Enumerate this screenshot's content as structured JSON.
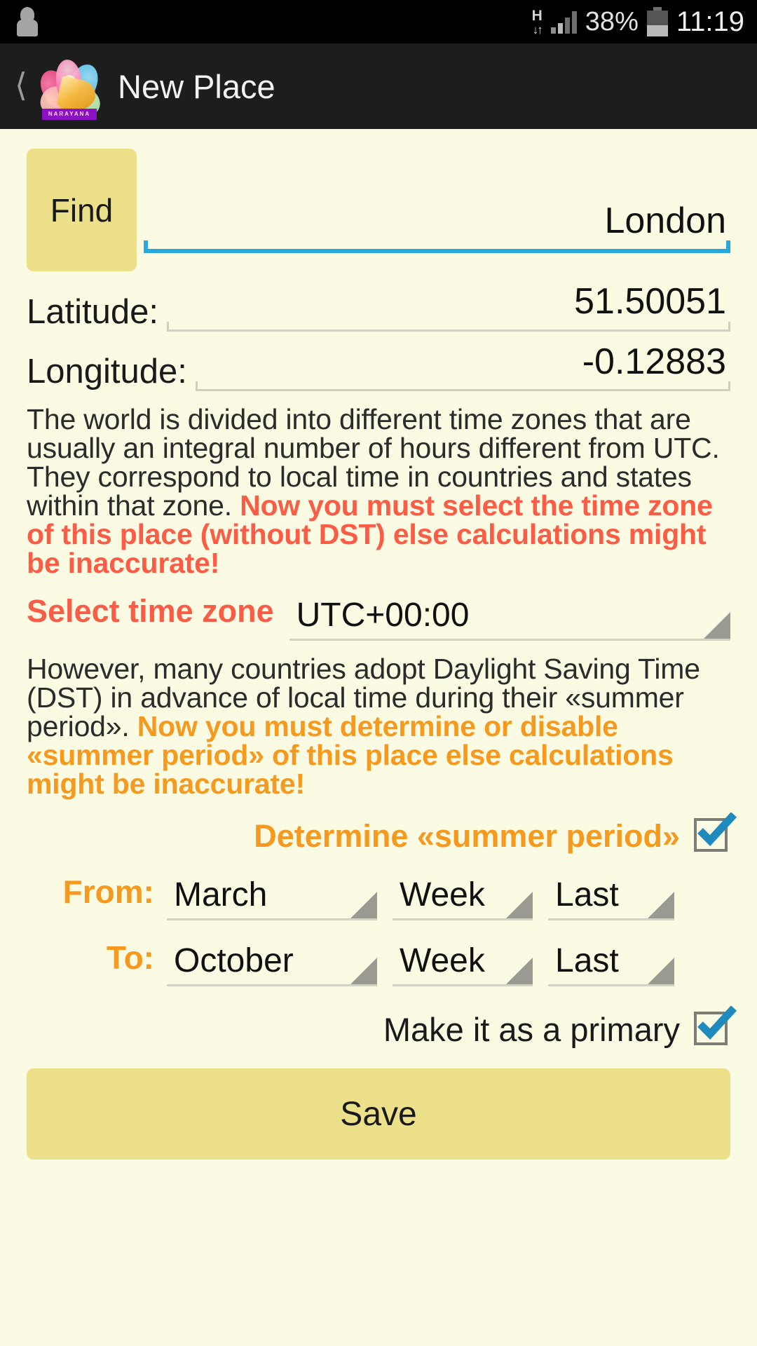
{
  "statusbar": {
    "notification_icon": "statue-icon",
    "network_type": "H",
    "network_arrows": "↓↑",
    "signal_icon": "signal-bars-icon",
    "battery_percent": "38%",
    "battery_icon": "battery-icon",
    "clock": "11:19"
  },
  "actionbar": {
    "back_icon": "back-chevron-icon",
    "app_logo": "lotus-logo-icon",
    "logo_ribbon": "NARAYANA",
    "title": "New Place"
  },
  "form": {
    "find_button": "Find",
    "city_value": "London",
    "latitude_label": "Latitude:",
    "latitude_value": "51.50051",
    "longitude_label": "Longitude:",
    "longitude_value": "-0.12883"
  },
  "timezone_section": {
    "paragraph_plain": "The world is divided into different time zones that are usually an integral number of hours different from UTC. They correspond to local time in countries and states within that zone. ",
    "paragraph_warning": "Now you must select the time zone of this place (without DST) else calculations might be inaccurate!",
    "select_label": "Select time zone",
    "selected_value": "UTC+00:00",
    "dropdown_icon": "spinner-triangle-icon"
  },
  "dst_section": {
    "paragraph_plain": "However, many countries adopt Daylight Saving Time (DST) in advance of local time during their «summer period». ",
    "paragraph_warning": "Now you must determine or disable «summer period» of this place else calculations might be inaccurate!",
    "determine_label": "Determine «summer period»",
    "determine_checked": true,
    "from_label": "From:",
    "from_month": "March",
    "from_unit": "Week",
    "from_ordinal": "Last",
    "to_label": "To:",
    "to_month": "October",
    "to_unit": "Week",
    "to_ordinal": "Last"
  },
  "footer": {
    "primary_label": "Make it as a primary",
    "primary_checked": true,
    "save_button": "Save"
  },
  "colors": {
    "page_bg": "#FBFBE4",
    "accent_yellow": "#EDE08A",
    "warning_red": "#FA5C46",
    "warning_orange": "#F59A1E",
    "focus_blue": "#29A8DF",
    "check_blue": "#1E8ABE"
  }
}
